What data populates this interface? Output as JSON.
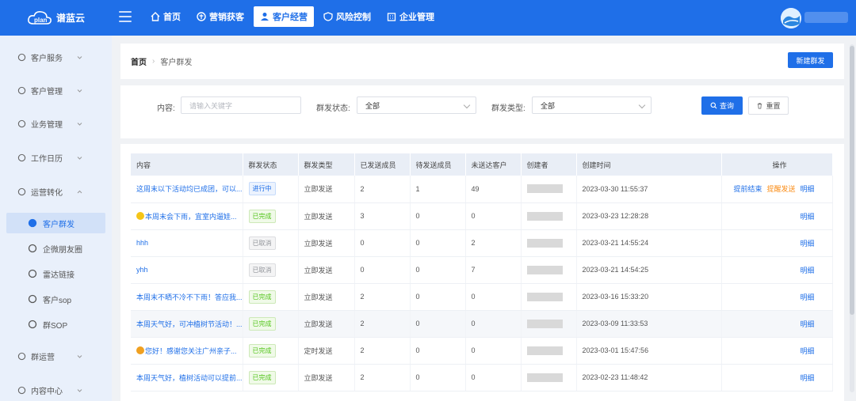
{
  "app": {
    "name": "谱蓝云"
  },
  "nav": [
    {
      "label": "首页",
      "icon": "home-icon"
    },
    {
      "label": "营销获客",
      "icon": "marketing-icon"
    },
    {
      "label": "客户经营",
      "icon": "user-icon",
      "active": true
    },
    {
      "label": "风险控制",
      "icon": "shield-icon"
    },
    {
      "label": "企业管理",
      "icon": "building-icon"
    }
  ],
  "sidebar": {
    "items": [
      {
        "label": "客户服务",
        "icon": "customer-service-icon"
      },
      {
        "label": "客户管理",
        "icon": "customer-manage-icon"
      },
      {
        "label": "业务管理",
        "icon": "business-icon"
      },
      {
        "label": "工作日历",
        "icon": "calendar-icon"
      },
      {
        "label": "运营转化",
        "icon": "operation-icon",
        "expanded": true
      },
      {
        "label": "群运营",
        "icon": "group-icon"
      },
      {
        "label": "内容中心",
        "icon": "content-icon"
      }
    ],
    "sub_items": [
      {
        "label": "客户群发",
        "icon": "group-send-icon",
        "active": true
      },
      {
        "label": "企微朋友圈",
        "icon": "moments-icon"
      },
      {
        "label": "雷达链接",
        "icon": "radar-icon"
      },
      {
        "label": "客户sop",
        "icon": "sop-icon"
      },
      {
        "label": "群SOP",
        "icon": "chat-icon"
      }
    ]
  },
  "breadcrumb": {
    "home": "首页",
    "current": "客户群发"
  },
  "actions": {
    "new": "新建群发"
  },
  "filters": {
    "content_label": "内容:",
    "content_placeholder": "请输入关键字",
    "status_label": "群发状态:",
    "status_value": "全部",
    "type_label": "群发类型:",
    "type_value": "全部",
    "query": "查询",
    "reset": "重置"
  },
  "table": {
    "columns": [
      "内容",
      "群发状态",
      "群发类型",
      "已发送成员",
      "待发送成员",
      "未送达客户",
      "创建者",
      "创建时间",
      "操作"
    ],
    "rows": [
      {
        "content": "这周末以下活动均已成团，可以...",
        "status": "进行中",
        "status_kind": "run",
        "type": "立即发送",
        "sent": "2",
        "pending": "1",
        "undelivered": "49",
        "time": "2023-03-30 11:55:37",
        "ops": [
          {
            "label": "提前结束",
            "color": "blue"
          },
          {
            "label": "提醒发送",
            "color": "orange"
          },
          {
            "label": "明细",
            "color": "blue"
          }
        ]
      },
      {
        "content": "本周末会下雨，宜室内遛娃...",
        "emoji": "heart",
        "status": "已完成",
        "status_kind": "done",
        "type": "立即发送",
        "sent": "3",
        "pending": "0",
        "undelivered": "0",
        "time": "2023-03-23 12:28:28",
        "ops": [
          {
            "label": "明细",
            "color": "blue"
          }
        ]
      },
      {
        "content": "hhh",
        "status": "已取消",
        "status_kind": "cancel",
        "type": "立即发送",
        "sent": "0",
        "pending": "0",
        "undelivered": "2",
        "time": "2023-03-21 14:55:24",
        "ops": [
          {
            "label": "明细",
            "color": "blue"
          }
        ]
      },
      {
        "content": "yhh",
        "status": "已取消",
        "status_kind": "cancel",
        "type": "立即发送",
        "sent": "0",
        "pending": "0",
        "undelivered": "7",
        "time": "2023-03-21 14:54:25",
        "ops": [
          {
            "label": "明细",
            "color": "blue"
          }
        ]
      },
      {
        "content": "本周末不晒不冷不下雨！答应我...",
        "status": "已完成",
        "status_kind": "done",
        "type": "立即发送",
        "sent": "2",
        "pending": "0",
        "undelivered": "0",
        "time": "2023-03-16 15:33:20",
        "ops": [
          {
            "label": "明细",
            "color": "blue"
          }
        ]
      },
      {
        "content": "本周天气好，可冲植树节活动！...",
        "status": "已完成",
        "status_kind": "done",
        "type": "立即发送",
        "sent": "2",
        "pending": "0",
        "undelivered": "0",
        "time": "2023-03-09 11:33:53",
        "highlight": true,
        "ops": [
          {
            "label": "明细",
            "color": "blue"
          }
        ]
      },
      {
        "content": "您好！感谢您关注广州亲子...",
        "emoji": "smile",
        "status": "已完成",
        "status_kind": "done",
        "type": "定时发送",
        "sent": "2",
        "pending": "0",
        "undelivered": "0",
        "time": "2023-03-01 15:47:56",
        "ops": [
          {
            "label": "明细",
            "color": "blue"
          }
        ]
      },
      {
        "content": "本周天气好，植树活动可以提前...",
        "status": "已完成",
        "status_kind": "done",
        "type": "立即发送",
        "sent": "2",
        "pending": "0",
        "undelivered": "0",
        "time": "2023-02-23 11:48:42",
        "ops": [
          {
            "label": "明细",
            "color": "blue"
          }
        ]
      }
    ]
  },
  "colors": {
    "primary": "#1f6fe8",
    "success": "#52c41a",
    "warning": "#fa8c16",
    "muted": "#909399"
  }
}
